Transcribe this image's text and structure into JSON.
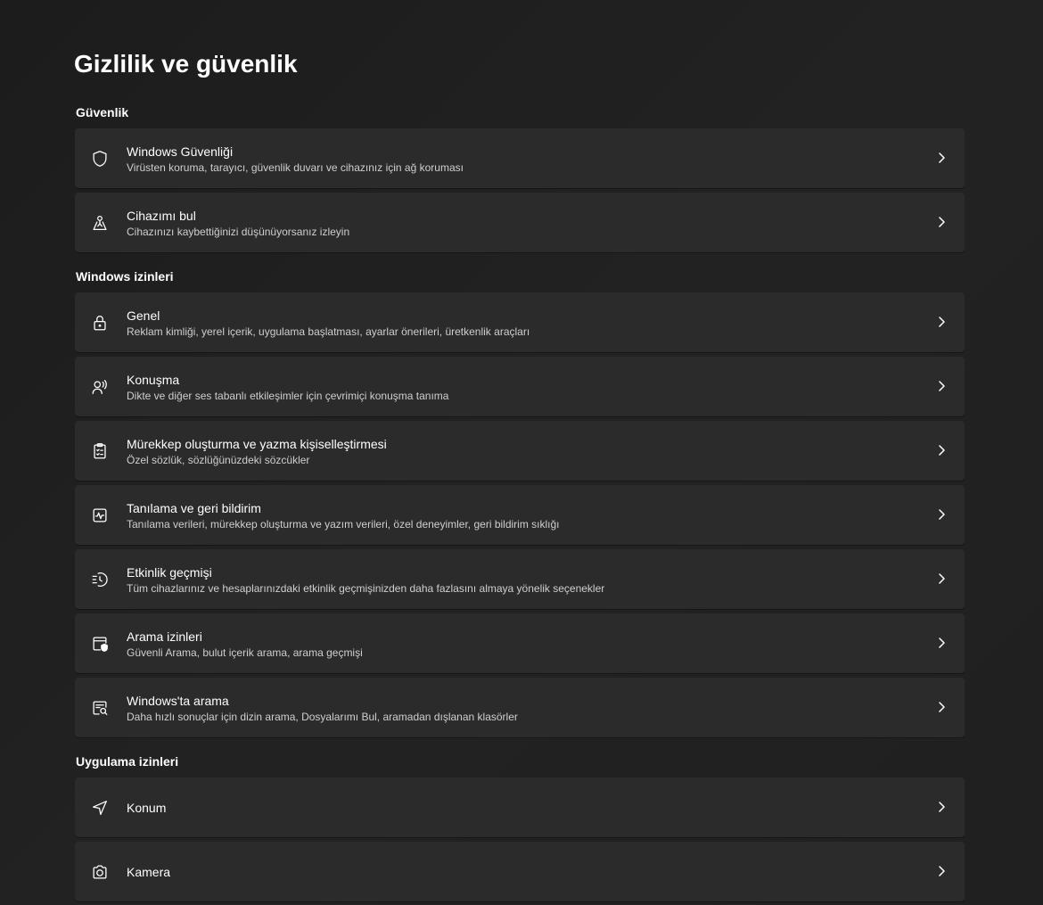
{
  "page": {
    "title": "Gizlilik ve güvenlik"
  },
  "sections": {
    "security": {
      "header": "Güvenlik",
      "items": [
        {
          "title": "Windows Güvenliği",
          "desc": "Virüsten koruma, tarayıcı, güvenlik duvarı ve cihazınız için ağ koruması",
          "icon": "shield-icon"
        },
        {
          "title": "Cihazımı bul",
          "desc": "Cihazınızı kaybettiğinizi düşünüyorsanız izleyin",
          "icon": "find-device-icon"
        }
      ]
    },
    "windows_permissions": {
      "header": "Windows izinleri",
      "items": [
        {
          "title": "Genel",
          "desc": "Reklam kimliği, yerel içerik, uygulama başlatması, ayarlar önerileri, üretkenlik araçları",
          "icon": "lock-icon"
        },
        {
          "title": "Konuşma",
          "desc": "Dikte ve diğer ses tabanlı etkileşimler için çevrimiçi konuşma tanıma",
          "icon": "speech-icon"
        },
        {
          "title": "Mürekkep oluşturma ve yazma kişiselleştirmesi",
          "desc": "Özel sözlük, sözlüğünüzdeki sözcükler",
          "icon": "clipboard-checklist-icon"
        },
        {
          "title": "Tanılama ve geri bildirim",
          "desc": "Tanılama verileri, mürekkep oluşturma ve yazım verileri, özel deneyimler, geri bildirim sıklığı",
          "icon": "diagnostics-icon"
        },
        {
          "title": "Etkinlik geçmişi",
          "desc": "Tüm cihazlarınız ve hesaplarınızdaki etkinlik geçmişinizden daha fazlasını almaya yönelik seçenekler",
          "icon": "history-icon"
        },
        {
          "title": "Arama izinleri",
          "desc": "Güvenli Arama, bulut içerik arama, arama geçmişi",
          "icon": "search-permissions-icon"
        },
        {
          "title": "Windows'ta arama",
          "desc": "Daha hızlı sonuçlar için dizin arama, Dosyalarımı Bul, aramadan dışlanan klasörler",
          "icon": "search-windows-icon"
        }
      ]
    },
    "app_permissions": {
      "header": "Uygulama izinleri",
      "items": [
        {
          "title": "Konum",
          "icon": "location-icon"
        },
        {
          "title": "Kamera",
          "icon": "camera-icon"
        }
      ]
    }
  },
  "colors": {
    "background": "#202020",
    "card": "#2b2b2b",
    "text": "#ffffff",
    "secondary_text": "#cfcfcf"
  }
}
